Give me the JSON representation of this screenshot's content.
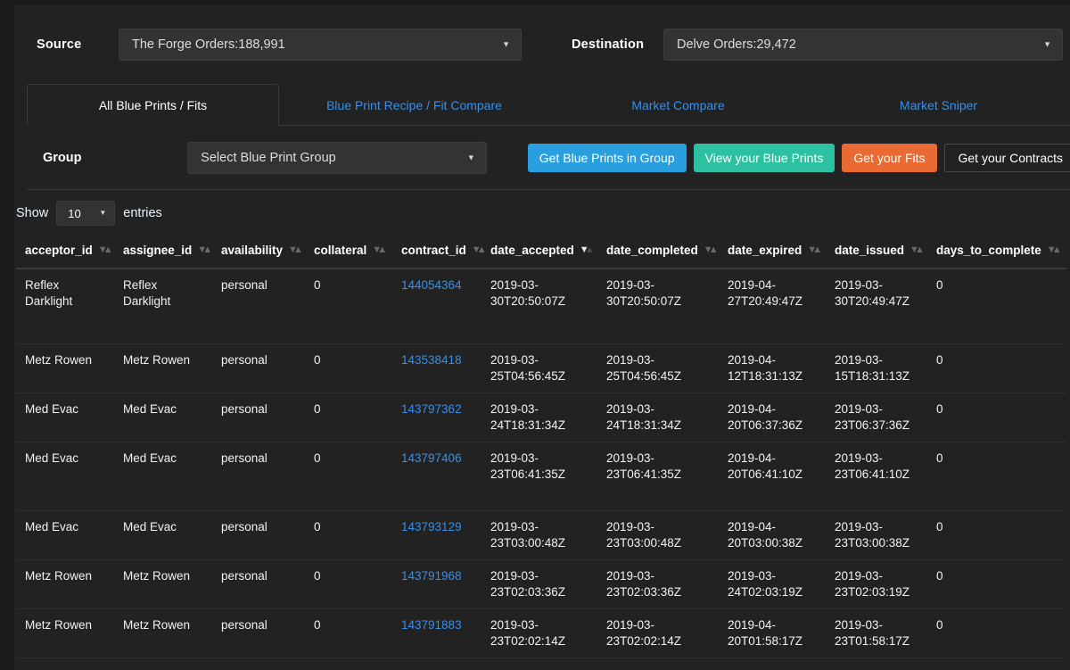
{
  "source": {
    "label": "Source",
    "value": "The Forge Orders:188,991",
    "caret": "▼"
  },
  "destination": {
    "label": "Destination",
    "value": "Delve Orders:29,472",
    "caret": "▼"
  },
  "tabs": [
    {
      "label": "All Blue Prints / Fits",
      "active": true
    },
    {
      "label": "Blue Print Recipe / Fit Compare",
      "active": false
    },
    {
      "label": "Market Compare",
      "active": false
    },
    {
      "label": "Market Sniper",
      "active": false
    }
  ],
  "group": {
    "label": "Group",
    "select_value": "Select Blue Print Group",
    "caret": "▼",
    "buttons": [
      {
        "label": "Get Blue Prints in Group",
        "color": "#2a9fe0"
      },
      {
        "label": "View your Blue Prints",
        "color": "#2cc1a0"
      },
      {
        "label": "Get your Fits",
        "color": "#ea6a33"
      },
      {
        "label": "Get your Contracts",
        "color": "#222222"
      }
    ]
  },
  "show_entries": {
    "prefix": "Show",
    "value": "10",
    "suffix": "entries",
    "caret": "▼"
  },
  "table": {
    "columns": [
      {
        "key": "acceptor_id",
        "label": "acceptor_id",
        "sort": "none"
      },
      {
        "key": "assignee_id",
        "label": "assignee_id",
        "sort": "none"
      },
      {
        "key": "availability",
        "label": "availability",
        "sort": "none"
      },
      {
        "key": "collateral",
        "label": "collateral",
        "sort": "none"
      },
      {
        "key": "contract_id",
        "label": "contract_id",
        "sort": "none"
      },
      {
        "key": "date_accepted",
        "label": "date_accepted",
        "sort": "desc"
      },
      {
        "key": "date_completed",
        "label": "date_completed",
        "sort": "none"
      },
      {
        "key": "date_expired",
        "label": "date_expired",
        "sort": "none"
      },
      {
        "key": "date_issued",
        "label": "date_issued",
        "sort": "none"
      },
      {
        "key": "days_to_complete",
        "label": "days_to_complete",
        "sort": "none"
      }
    ],
    "sort_icons": {
      "down": "▼",
      "up": "▲"
    },
    "rows": [
      {
        "acceptor_id": "Reflex Darklight",
        "assignee_id": "Reflex Darklight",
        "availability": "personal",
        "collateral": "0",
        "contract_id": "144054364",
        "date_accepted": "2019-03-30T20:50:07Z",
        "date_completed": "2019-03-30T20:50:07Z",
        "date_expired": "2019-04-27T20:49:47Z",
        "date_issued": "2019-03-30T20:49:47Z",
        "days_to_complete": "0",
        "height": "tall"
      },
      {
        "acceptor_id": "Metz Rowen",
        "assignee_id": "Metz Rowen",
        "availability": "personal",
        "collateral": "0",
        "contract_id": "143538418",
        "date_accepted": "2019-03-25T04:56:45Z",
        "date_completed": "2019-03-25T04:56:45Z",
        "date_expired": "2019-04-12T18:31:13Z",
        "date_issued": "2019-03-15T18:31:13Z",
        "days_to_complete": "0",
        "height": "normal"
      },
      {
        "acceptor_id": "Med Evac",
        "assignee_id": "Med Evac",
        "availability": "personal",
        "collateral": "0",
        "contract_id": "143797362",
        "date_accepted": "2019-03-24T18:31:34Z",
        "date_completed": "2019-03-24T18:31:34Z",
        "date_expired": "2019-04-20T06:37:36Z",
        "date_issued": "2019-03-23T06:37:36Z",
        "days_to_complete": "0",
        "height": "normal"
      },
      {
        "acceptor_id": "Med Evac",
        "assignee_id": "Med Evac",
        "availability": "personal",
        "collateral": "0",
        "contract_id": "143797406",
        "date_accepted": "2019-03-23T06:41:35Z",
        "date_completed": "2019-03-23T06:41:35Z",
        "date_expired": "2019-04-20T06:41:10Z",
        "date_issued": "2019-03-23T06:41:10Z",
        "days_to_complete": "0",
        "height": "tall2"
      },
      {
        "acceptor_id": "Med Evac",
        "assignee_id": "Med Evac",
        "availability": "personal",
        "collateral": "0",
        "contract_id": "143793129",
        "date_accepted": "2019-03-23T03:00:48Z",
        "date_completed": "2019-03-23T03:00:48Z",
        "date_expired": "2019-04-20T03:00:38Z",
        "date_issued": "2019-03-23T03:00:38Z",
        "days_to_complete": "0",
        "height": "normal"
      },
      {
        "acceptor_id": "Metz Rowen",
        "assignee_id": "Metz Rowen",
        "availability": "personal",
        "collateral": "0",
        "contract_id": "143791968",
        "date_accepted": "2019-03-23T02:03:36Z",
        "date_completed": "2019-03-23T02:03:36Z",
        "date_expired": "2019-03-24T02:03:19Z",
        "date_issued": "2019-03-23T02:03:19Z",
        "days_to_complete": "0",
        "height": "normal"
      },
      {
        "acceptor_id": "Metz Rowen",
        "assignee_id": "Metz Rowen",
        "availability": "personal",
        "collateral": "0",
        "contract_id": "143791883",
        "date_accepted": "2019-03-23T02:02:14Z",
        "date_completed": "2019-03-23T02:02:14Z",
        "date_expired": "2019-04-20T01:58:17Z",
        "date_issued": "2019-03-23T01:58:17Z",
        "days_to_complete": "0",
        "height": "normal"
      }
    ]
  }
}
